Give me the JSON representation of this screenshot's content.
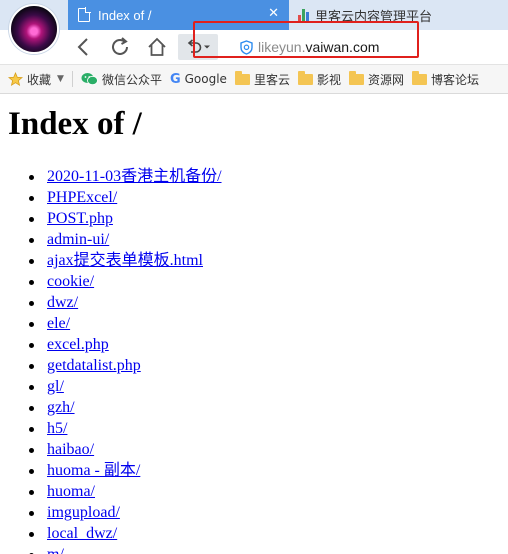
{
  "tabs": {
    "active": {
      "title": "Index of /",
      "close": "✕"
    },
    "inactive": {
      "title": "里客云内容管理平台"
    }
  },
  "nav": {
    "url_host_sub": "likeyun.",
    "url_host_main": "vaiwan.com"
  },
  "bookmarks": [
    {
      "label": "收藏",
      "icon": "star-icon"
    },
    {
      "label": "微信公众平",
      "icon": "wechat-icon"
    },
    {
      "label": "Google",
      "icon": "google-icon"
    },
    {
      "label": "里客云",
      "icon": "folder-icon"
    },
    {
      "label": "影视",
      "icon": "folder-icon"
    },
    {
      "label": "资源网",
      "icon": "folder-icon"
    },
    {
      "label": "博客论坛",
      "icon": "folder-icon"
    }
  ],
  "page": {
    "heading": "Index of /",
    "entries": [
      "2020-11-03香港主机备份/",
      "PHPExcel/",
      "POST.php",
      "admin-ui/",
      "ajax提交表单模板.html",
      "cookie/",
      "dwz/",
      "ele/",
      "excel.php",
      "getdatalist.php",
      "gl/",
      "gzh/",
      "h5/",
      "haibao/",
      "huoma - 副本/",
      "huoma/",
      "imgupload/",
      "local_dwz/",
      "m/"
    ]
  },
  "colors": {
    "active_tab": "#4a90e2",
    "link": "#0000ee",
    "highlight_box": "#e0201c"
  }
}
